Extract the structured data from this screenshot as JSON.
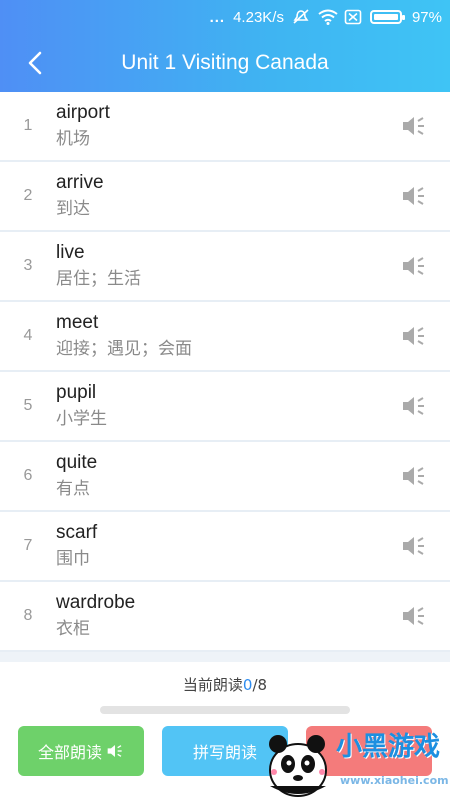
{
  "status_bar": {
    "dots": "...",
    "speed": "4.23K/s",
    "battery": "97%"
  },
  "header": {
    "title": "Unit 1 Visiting Canada"
  },
  "words": [
    {
      "index": "1",
      "en": "airport",
      "cn": "机场"
    },
    {
      "index": "2",
      "en": "arrive",
      "cn": "到达"
    },
    {
      "index": "3",
      "en": "live",
      "cn": "居住；生活"
    },
    {
      "index": "4",
      "en": "meet",
      "cn": "迎接；遇见；会面"
    },
    {
      "index": "5",
      "en": "pupil",
      "cn": "小学生"
    },
    {
      "index": "6",
      "en": "quite",
      "cn": "有点"
    },
    {
      "index": "7",
      "en": "scarf",
      "cn": "围巾"
    },
    {
      "index": "8",
      "en": "wardrobe",
      "cn": "衣柜"
    }
  ],
  "progress": {
    "prefix": "当前朗读",
    "current": "0",
    "separator": "/",
    "total": "8",
    "fraction": 0
  },
  "buttons": {
    "read_all": "全部朗读",
    "spell_read": "拼写朗读"
  },
  "watermark": {
    "brand": "小黑游戏",
    "url": "www.xiaohei.com"
  },
  "colors": {
    "header_start": "#4f8ff5",
    "header_end": "#3fc4f5",
    "read_all_button": "#6ed16a",
    "spell_button": "#52c4f5",
    "third_button": "#f47b7b",
    "progress_accent": "#2d8cf0"
  }
}
